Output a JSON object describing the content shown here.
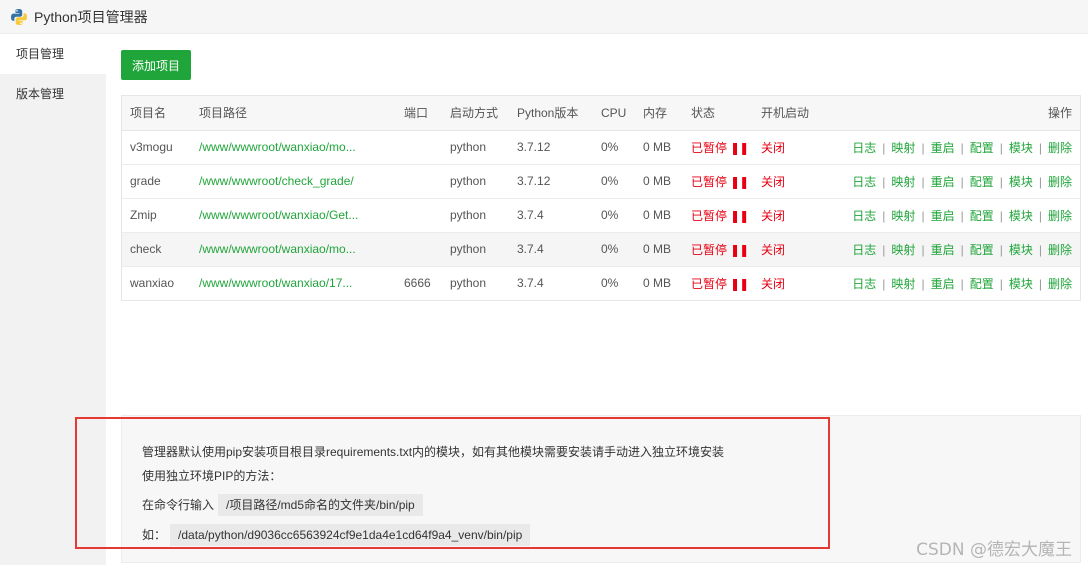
{
  "window": {
    "title": "Python项目管理器"
  },
  "sidebar": {
    "items": [
      {
        "label": "项目管理",
        "active": true
      },
      {
        "label": "版本管理",
        "active": false
      }
    ]
  },
  "toolbar": {
    "add_label": "添加项目"
  },
  "table": {
    "headers": [
      "项目名",
      "项目路径",
      "端口",
      "启动方式",
      "Python版本",
      "CPU",
      "内存",
      "状态",
      "开机启动",
      "操作"
    ],
    "rows": [
      {
        "name": "v3mogu",
        "path": "/www/wwwroot/wanxiao/mo...",
        "port": "",
        "mode": "python",
        "version": "3.7.12",
        "cpu": "0%",
        "mem": "0 MB",
        "status": "已暂停",
        "boot": "关闭"
      },
      {
        "name": "grade",
        "path": "/www/wwwroot/check_grade/",
        "port": "",
        "mode": "python",
        "version": "3.7.12",
        "cpu": "0%",
        "mem": "0 MB",
        "status": "已暂停",
        "boot": "关闭"
      },
      {
        "name": "Zmip",
        "path": "/www/wwwroot/wanxiao/Get...",
        "port": "",
        "mode": "python",
        "version": "3.7.4",
        "cpu": "0%",
        "mem": "0 MB",
        "status": "已暂停",
        "boot": "关闭"
      },
      {
        "name": "check",
        "path": "/www/wwwroot/wanxiao/mo...",
        "port": "",
        "mode": "python",
        "version": "3.7.4",
        "cpu": "0%",
        "mem": "0 MB",
        "status": "已暂停",
        "boot": "关闭"
      },
      {
        "name": "wanxiao",
        "path": "/www/wwwroot/wanxiao/17...",
        "port": "6666",
        "mode": "python",
        "version": "3.7.4",
        "cpu": "0%",
        "mem": "0 MB",
        "status": "已暂停",
        "boot": "关闭"
      }
    ],
    "status_pause_glyph": "❚❚",
    "actions": [
      "日志",
      "映射",
      "重启",
      "配置",
      "模块",
      "删除"
    ],
    "action_separator": "|"
  },
  "info": {
    "line1": "管理器默认使用pip安装项目根目录requirements.txt内的模块，如有其他模块需要安装请手动进入独立环境安装",
    "line2": "使用独立环境PIP的方法：",
    "line3_label": "在命令行输入",
    "line3_code": "/项目路径/md5命名的文件夹/bin/pip",
    "line4_label": "如：",
    "line4_code": "/data/python/d9036cc6563924cf9e1da4e1cd64f9a4_venv/bin/pip"
  },
  "watermark": "CSDN @德宏大魔王",
  "colors": {
    "accent": "#20a53a",
    "danger": "#e60012",
    "highlight_frame": "#e53935"
  }
}
